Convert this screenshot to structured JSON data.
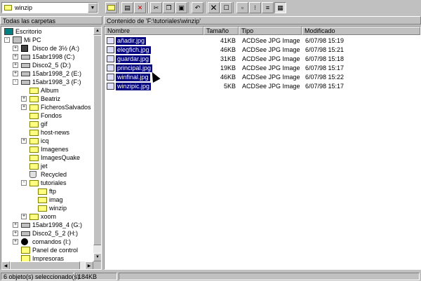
{
  "address": {
    "value": "winzip"
  },
  "toolbar": {
    "buttons": [
      {
        "name": "up-folder"
      },
      {
        "name": "map-drive"
      },
      {
        "name": "disconnect-drive"
      },
      {
        "name": "cut"
      },
      {
        "name": "copy"
      },
      {
        "name": "paste"
      },
      {
        "name": "undo"
      },
      {
        "name": "delete"
      },
      {
        "name": "properties"
      },
      {
        "name": "large-icons"
      },
      {
        "name": "small-icons"
      },
      {
        "name": "list"
      },
      {
        "name": "details"
      }
    ]
  },
  "left_header": "Todas las carpetas",
  "right_header": "Contenido de 'F:\\tutoriales\\winzip'",
  "tree": [
    {
      "label": "Escritorio",
      "level": 0,
      "toggle": "",
      "icon": "desktop"
    },
    {
      "label": "Mi PC",
      "level": 1,
      "toggle": "-",
      "icon": "pc"
    },
    {
      "label": "Disco de 3½ (A:)",
      "level": 2,
      "toggle": "+",
      "icon": "floppy"
    },
    {
      "label": "15abr1998 (C:)",
      "level": 2,
      "toggle": "+",
      "icon": "drive"
    },
    {
      "label": "Disco2_5 (D:)",
      "level": 2,
      "toggle": "+",
      "icon": "drive"
    },
    {
      "label": "15abr1998_2 (E:)",
      "level": 2,
      "toggle": "+",
      "icon": "drive"
    },
    {
      "label": "15abr1998_3 (F:)",
      "level": 2,
      "toggle": "-",
      "icon": "drive"
    },
    {
      "label": "Album",
      "level": 3,
      "toggle": "",
      "icon": "folder"
    },
    {
      "label": "Beatriz",
      "level": 3,
      "toggle": "+",
      "icon": "folder"
    },
    {
      "label": "FicherosSalvados",
      "level": 3,
      "toggle": "+",
      "icon": "folder"
    },
    {
      "label": "Fondos",
      "level": 3,
      "toggle": "",
      "icon": "folder"
    },
    {
      "label": "gif",
      "level": 3,
      "toggle": "",
      "icon": "folder"
    },
    {
      "label": "host-news",
      "level": 3,
      "toggle": "",
      "icon": "folder"
    },
    {
      "label": "icq",
      "level": 3,
      "toggle": "+",
      "icon": "folder"
    },
    {
      "label": "Imagenes",
      "level": 3,
      "toggle": "",
      "icon": "folder"
    },
    {
      "label": "ImagesQuake",
      "level": 3,
      "toggle": "",
      "icon": "folder"
    },
    {
      "label": "jet",
      "level": 3,
      "toggle": "",
      "icon": "folder"
    },
    {
      "label": "Recycled",
      "level": 3,
      "toggle": "",
      "icon": "recycle"
    },
    {
      "label": "tutoriales",
      "level": 3,
      "toggle": "-",
      "icon": "folder"
    },
    {
      "label": "ftp",
      "level": 4,
      "toggle": "",
      "icon": "folder"
    },
    {
      "label": "imag",
      "level": 4,
      "toggle": "",
      "icon": "folder"
    },
    {
      "label": "winzip",
      "level": 4,
      "toggle": "",
      "icon": "folder-open"
    },
    {
      "label": "xoom",
      "level": 3,
      "toggle": "+",
      "icon": "folder"
    },
    {
      "label": "15abr1998_4 (G:)",
      "level": 2,
      "toggle": "+",
      "icon": "drive"
    },
    {
      "label": "Disco2_5_2 (H:)",
      "level": 2,
      "toggle": "+",
      "icon": "drive"
    },
    {
      "label": "comandos (I:)",
      "level": 2,
      "toggle": "+",
      "icon": "cd"
    },
    {
      "label": "Panel de control",
      "level": 2,
      "toggle": "",
      "icon": "panel"
    },
    {
      "label": "Impresoras",
      "level": 2,
      "toggle": "",
      "icon": "panel"
    }
  ],
  "columns": [
    "Nombre",
    "Tamaño",
    "Tipo",
    "Modificado"
  ],
  "files": [
    {
      "name": "añadir.jpg",
      "size": "41KB",
      "type": "ACDSee JPG Image",
      "modified": "6/07/98 15:19"
    },
    {
      "name": "elegfich.jpg",
      "size": "46KB",
      "type": "ACDSee JPG Image",
      "modified": "6/07/98 15:21"
    },
    {
      "name": "guardar.jpg",
      "size": "31KB",
      "type": "ACDSee JPG Image",
      "modified": "6/07/98 15:18"
    },
    {
      "name": "principal.jpg",
      "size": "19KB",
      "type": "ACDSee JPG Image",
      "modified": "6/07/98 15:17"
    },
    {
      "name": "winfinal.jpg",
      "size": "46KB",
      "type": "ACDSee JPG Image",
      "modified": "6/07/98 15:22"
    },
    {
      "name": "winzipic.jpg",
      "size": "5KB",
      "type": "ACDSee JPG Image",
      "modified": "6/07/98 15:17"
    }
  ],
  "status": {
    "selection": "6 objeto(s) seleccionado(s)",
    "size": "184KB"
  }
}
